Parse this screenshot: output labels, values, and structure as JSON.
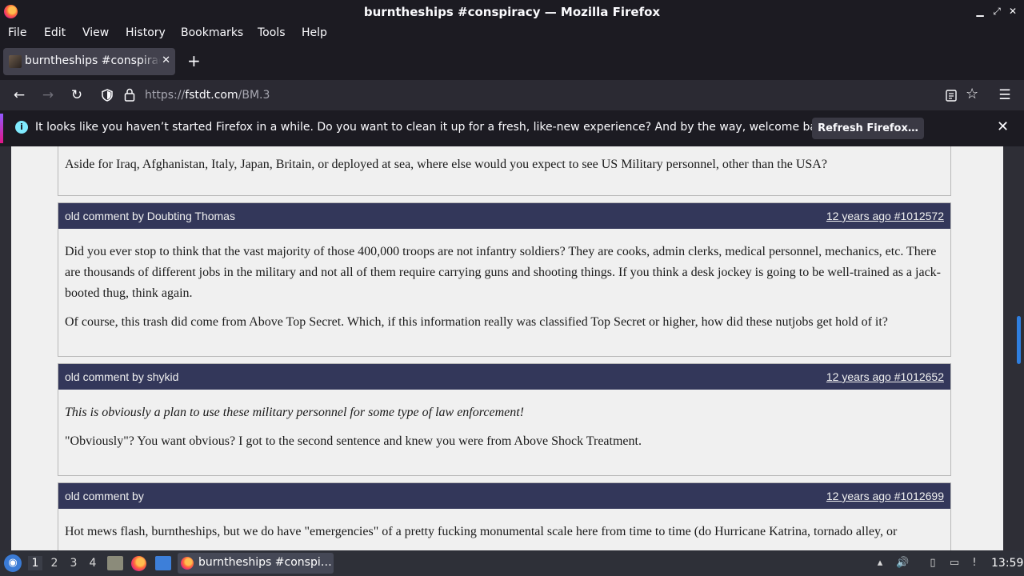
{
  "window": {
    "title": "burntheships #conspiracy — Mozilla Firefox"
  },
  "menu": [
    "File",
    "Edit",
    "View",
    "History",
    "Bookmarks",
    "Tools",
    "Help"
  ],
  "tab": {
    "title": "burntheships #conspiracy",
    "close": "✕",
    "new": "+"
  },
  "url": {
    "scheme": "https://",
    "host": "fstdt.com",
    "path": "/BM.3"
  },
  "notification": {
    "message": "It looks like you haven’t started Firefox in a while. Do you want to clean it up for a fresh, like-new experience? And by the way, welcome back!",
    "button": "Refresh Firefox…",
    "info": "i"
  },
  "posts": [
    {
      "paragraphs": [
        "Aside for Iraq, Afghanistan, Italy, Japan, Britain, or deployed at sea, where else would you expect to see US Military personnel, other than the USA?"
      ]
    },
    {
      "who": "old comment by Doubting Thomas",
      "when": "12 years ago #1012572",
      "paragraphs": [
        "Did you ever stop to think that the vast majority of those 400,000 troops are not infantry soldiers? They are cooks, admin clerks, medical personnel, mechanics, etc. There are thousands of different jobs in the military and not all of them require carrying guns and shooting things. If you think a desk jockey is going to be well-trained as a jack-booted thug, think again.",
        "Of course, this trash did come from Above Top Secret. Which, if this information really was classified Top Secret or higher, how did these nutjobs get hold of it?"
      ]
    },
    {
      "who": "old comment by shykid",
      "when": "12 years ago #1012652",
      "quote": "This is obviously a plan to use these military personnel for some type of law enforcement!",
      "paragraphs": [
        "\"Obviously\"? You want obvious? I got to the second sentence and knew you were from Above Shock Treatment."
      ]
    },
    {
      "who": "old comment by",
      "when": "12 years ago #1012699",
      "paragraphs": [
        "Hot mews flash, burntheships, but we do have \"emergencies\" of a pretty fucking monumental scale here from time to time (do Hurricane Katrina, tornado alley, or"
      ]
    }
  ],
  "taskbar": {
    "workspaces": [
      "1",
      "2",
      "3",
      "4"
    ],
    "task_label": "burntheships #conspi…",
    "clock": "13:59"
  }
}
